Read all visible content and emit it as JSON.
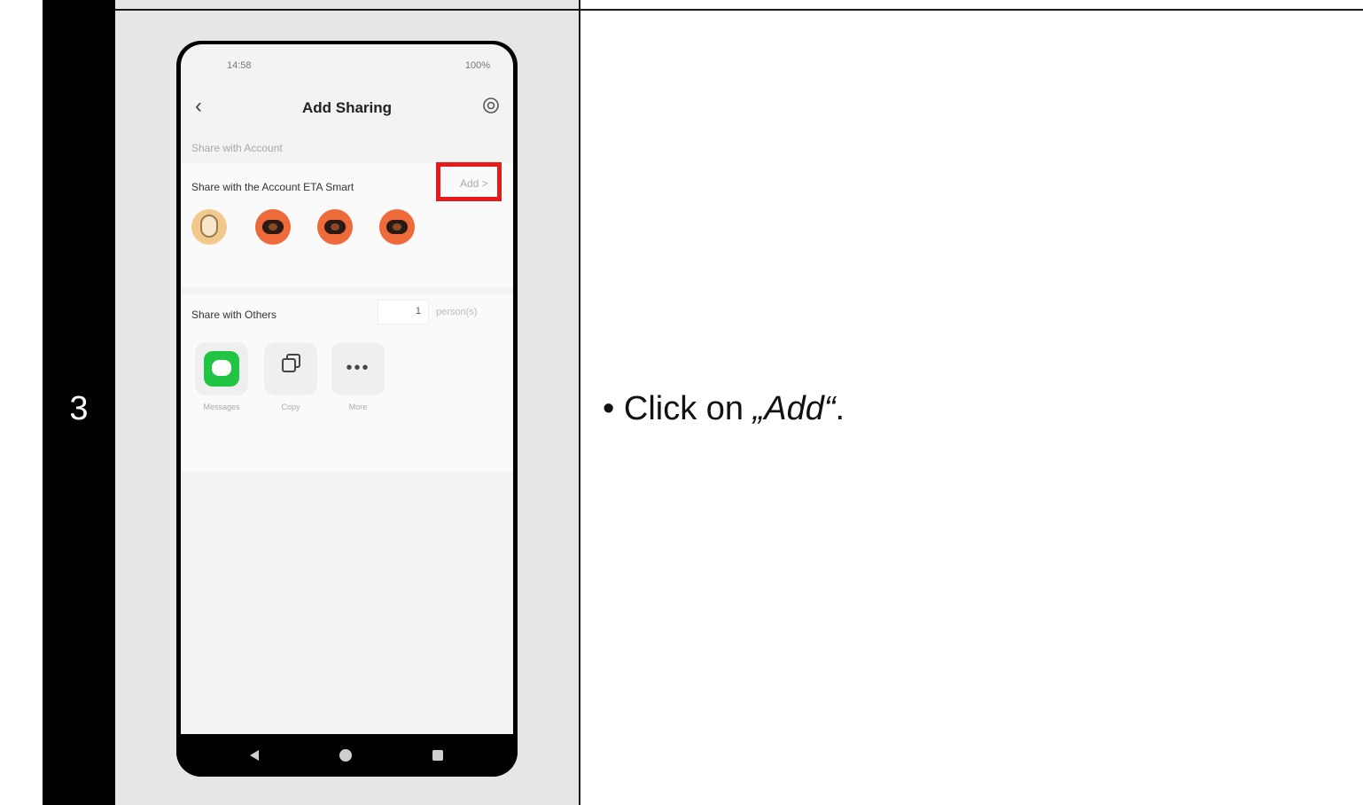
{
  "step": {
    "number": "3",
    "instruction_bullet": "•",
    "instruction_prefix": "Click on ",
    "instruction_quoted": "„Add“",
    "instruction_suffix": "."
  },
  "phone": {
    "status_time": "14:58",
    "status_right": "100%",
    "nav_title": "Add Sharing",
    "section_label": "Share with Account",
    "account_label": "Share with the Account ETA Smart",
    "add_label": "Add >",
    "others_label": "Share with Others",
    "persons_count": "1",
    "persons_unit": "person(s)",
    "share_options": [
      "Messages",
      "Copy",
      "More"
    ],
    "highlight_color": "#e31b1b"
  }
}
